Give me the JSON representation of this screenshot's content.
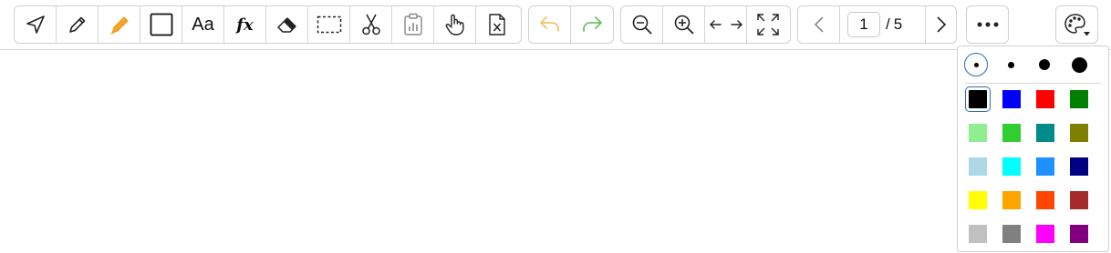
{
  "toolbar": {
    "tools": [
      {
        "name": "select-arrow-icon"
      },
      {
        "name": "pencil-icon"
      },
      {
        "name": "highlighter-icon",
        "color": "#f5a623"
      },
      {
        "name": "rectangle-icon"
      },
      {
        "name": "text-tool",
        "label": "Aa"
      },
      {
        "name": "formula-tool",
        "label": "fx"
      },
      {
        "name": "eraser-icon"
      },
      {
        "name": "marquee-select-icon"
      },
      {
        "name": "scissors-icon"
      },
      {
        "name": "clipboard-paste-icon"
      },
      {
        "name": "hand-pan-icon"
      },
      {
        "name": "delete-page-icon"
      }
    ],
    "history": [
      {
        "name": "undo-icon",
        "color": "#f5c16c"
      },
      {
        "name": "redo-icon",
        "color": "#6cc06c"
      }
    ],
    "view": [
      {
        "name": "zoom-out-icon"
      },
      {
        "name": "zoom-in-icon"
      },
      {
        "name": "fit-width-icon"
      },
      {
        "name": "fullscreen-icon"
      }
    ],
    "pager": {
      "current": "1",
      "separator": "/",
      "total": "5"
    },
    "more": {
      "name": "more-options-icon"
    },
    "palette": {
      "name": "palette-icon"
    }
  },
  "palette_panel": {
    "stroke_sizes": [
      "small",
      "medium",
      "large",
      "x-large"
    ],
    "selected_size": 0,
    "colors": [
      "#000000",
      "#0000ff",
      "#ff0000",
      "#008000",
      "#90ee90",
      "#32cd32",
      "#008b8b",
      "#808000",
      "#add8e6",
      "#00ffff",
      "#1e90ff",
      "#000080",
      "#ffff00",
      "#ffa500",
      "#ff4500",
      "#a52a2a",
      "#c0c0c0",
      "#808080",
      "#ff00ff",
      "#800080"
    ],
    "selected_color": 0
  }
}
